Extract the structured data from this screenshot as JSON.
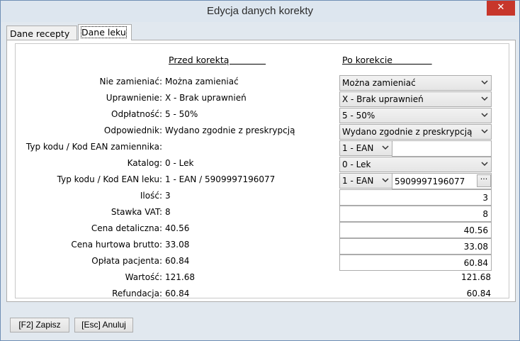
{
  "window": {
    "title": "Edycja danych korekty",
    "close_glyph": "✕"
  },
  "tabs": [
    {
      "label": "Dane recepty",
      "active": false
    },
    {
      "label": "Dane leku",
      "active": true
    }
  ],
  "headers": {
    "before": "Przed korektą             ",
    "after": "Po korekcie              "
  },
  "labels": {
    "substitute": "Nie zamieniać:",
    "entitlement": "Uprawnienie:",
    "payment": "Odpłatność:",
    "counterpart": "Odpowiednik:",
    "substitute_code": "Typ kodu / Kod EAN zamiennika:",
    "catalog": "Katalog:",
    "drug_code": "Typ kodu / Kod EAN leku:",
    "quantity": "Ilość:",
    "vat": "Stawka VAT:",
    "retail_price": "Cena detaliczna:",
    "wholesale_price": "Cena hurtowa brutto:",
    "patient_fee": "Opłata pacjenta:",
    "value": "Wartość:",
    "refund": "Refundacja:"
  },
  "before": {
    "substitute": "Można zamieniać",
    "entitlement": "X - Brak uprawnień",
    "payment": "5 - 50%",
    "counterpart": "Wydano zgodnie z preskrypcją",
    "catalog": "0 - Lek",
    "drug_code": "1 - EAN / 5909997196077",
    "quantity": "3",
    "vat": "8",
    "retail_price": "40.56",
    "wholesale_price": "33.08",
    "patient_fee": "60.84",
    "value": "121.68",
    "refund": "60.84"
  },
  "after": {
    "substitute": "Można zamieniać",
    "entitlement": "X - Brak uprawnień",
    "payment": "5 - 50%",
    "counterpart": "Wydano zgodnie z preskrypcją",
    "substitute_code_type": "1 - EAN",
    "substitute_code": "",
    "catalog": "0 - Lek",
    "drug_code_type": "1 - EAN",
    "drug_code": "5909997196077",
    "browse_glyph": "···",
    "quantity": "3",
    "vat": "8",
    "retail_price": "40.56",
    "wholesale_price": "33.08",
    "patient_fee": "60.84",
    "value": "121.68",
    "refund": "60.84"
  },
  "buttons": {
    "save": "[F2] Zapisz",
    "cancel": "[Esc] Anuluj"
  }
}
